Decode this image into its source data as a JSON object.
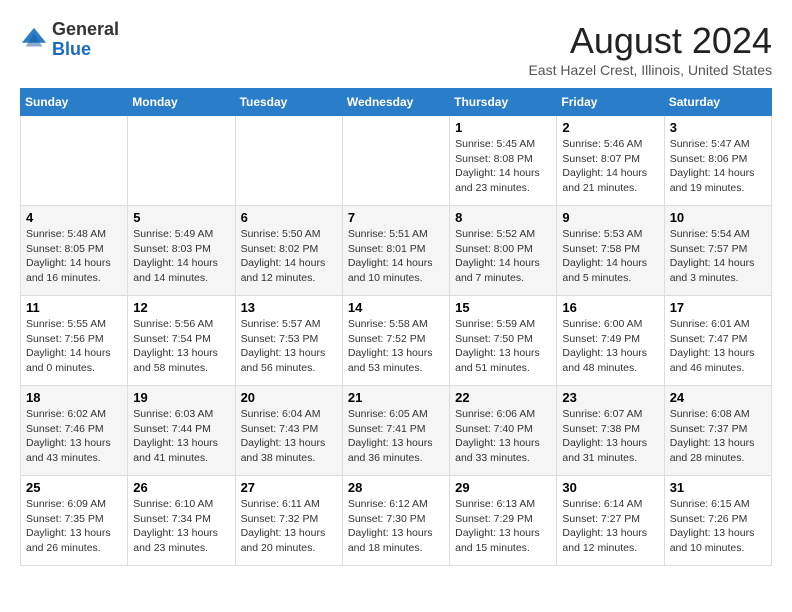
{
  "header": {
    "logo": {
      "line1": "General",
      "line2": "Blue"
    },
    "title": "August 2024",
    "location": "East Hazel Crest, Illinois, United States"
  },
  "weekdays": [
    "Sunday",
    "Monday",
    "Tuesday",
    "Wednesday",
    "Thursday",
    "Friday",
    "Saturday"
  ],
  "weeks": [
    [
      {
        "day": "",
        "sunrise": "",
        "sunset": "",
        "daylight": ""
      },
      {
        "day": "",
        "sunrise": "",
        "sunset": "",
        "daylight": ""
      },
      {
        "day": "",
        "sunrise": "",
        "sunset": "",
        "daylight": ""
      },
      {
        "day": "",
        "sunrise": "",
        "sunset": "",
        "daylight": ""
      },
      {
        "day": "1",
        "sunrise": "Sunrise: 5:45 AM",
        "sunset": "Sunset: 8:08 PM",
        "daylight": "Daylight: 14 hours and 23 minutes."
      },
      {
        "day": "2",
        "sunrise": "Sunrise: 5:46 AM",
        "sunset": "Sunset: 8:07 PM",
        "daylight": "Daylight: 14 hours and 21 minutes."
      },
      {
        "day": "3",
        "sunrise": "Sunrise: 5:47 AM",
        "sunset": "Sunset: 8:06 PM",
        "daylight": "Daylight: 14 hours and 19 minutes."
      }
    ],
    [
      {
        "day": "4",
        "sunrise": "Sunrise: 5:48 AM",
        "sunset": "Sunset: 8:05 PM",
        "daylight": "Daylight: 14 hours and 16 minutes."
      },
      {
        "day": "5",
        "sunrise": "Sunrise: 5:49 AM",
        "sunset": "Sunset: 8:03 PM",
        "daylight": "Daylight: 14 hours and 14 minutes."
      },
      {
        "day": "6",
        "sunrise": "Sunrise: 5:50 AM",
        "sunset": "Sunset: 8:02 PM",
        "daylight": "Daylight: 14 hours and 12 minutes."
      },
      {
        "day": "7",
        "sunrise": "Sunrise: 5:51 AM",
        "sunset": "Sunset: 8:01 PM",
        "daylight": "Daylight: 14 hours and 10 minutes."
      },
      {
        "day": "8",
        "sunrise": "Sunrise: 5:52 AM",
        "sunset": "Sunset: 8:00 PM",
        "daylight": "Daylight: 14 hours and 7 minutes."
      },
      {
        "day": "9",
        "sunrise": "Sunrise: 5:53 AM",
        "sunset": "Sunset: 7:58 PM",
        "daylight": "Daylight: 14 hours and 5 minutes."
      },
      {
        "day": "10",
        "sunrise": "Sunrise: 5:54 AM",
        "sunset": "Sunset: 7:57 PM",
        "daylight": "Daylight: 14 hours and 3 minutes."
      }
    ],
    [
      {
        "day": "11",
        "sunrise": "Sunrise: 5:55 AM",
        "sunset": "Sunset: 7:56 PM",
        "daylight": "Daylight: 14 hours and 0 minutes."
      },
      {
        "day": "12",
        "sunrise": "Sunrise: 5:56 AM",
        "sunset": "Sunset: 7:54 PM",
        "daylight": "Daylight: 13 hours and 58 minutes."
      },
      {
        "day": "13",
        "sunrise": "Sunrise: 5:57 AM",
        "sunset": "Sunset: 7:53 PM",
        "daylight": "Daylight: 13 hours and 56 minutes."
      },
      {
        "day": "14",
        "sunrise": "Sunrise: 5:58 AM",
        "sunset": "Sunset: 7:52 PM",
        "daylight": "Daylight: 13 hours and 53 minutes."
      },
      {
        "day": "15",
        "sunrise": "Sunrise: 5:59 AM",
        "sunset": "Sunset: 7:50 PM",
        "daylight": "Daylight: 13 hours and 51 minutes."
      },
      {
        "day": "16",
        "sunrise": "Sunrise: 6:00 AM",
        "sunset": "Sunset: 7:49 PM",
        "daylight": "Daylight: 13 hours and 48 minutes."
      },
      {
        "day": "17",
        "sunrise": "Sunrise: 6:01 AM",
        "sunset": "Sunset: 7:47 PM",
        "daylight": "Daylight: 13 hours and 46 minutes."
      }
    ],
    [
      {
        "day": "18",
        "sunrise": "Sunrise: 6:02 AM",
        "sunset": "Sunset: 7:46 PM",
        "daylight": "Daylight: 13 hours and 43 minutes."
      },
      {
        "day": "19",
        "sunrise": "Sunrise: 6:03 AM",
        "sunset": "Sunset: 7:44 PM",
        "daylight": "Daylight: 13 hours and 41 minutes."
      },
      {
        "day": "20",
        "sunrise": "Sunrise: 6:04 AM",
        "sunset": "Sunset: 7:43 PM",
        "daylight": "Daylight: 13 hours and 38 minutes."
      },
      {
        "day": "21",
        "sunrise": "Sunrise: 6:05 AM",
        "sunset": "Sunset: 7:41 PM",
        "daylight": "Daylight: 13 hours and 36 minutes."
      },
      {
        "day": "22",
        "sunrise": "Sunrise: 6:06 AM",
        "sunset": "Sunset: 7:40 PM",
        "daylight": "Daylight: 13 hours and 33 minutes."
      },
      {
        "day": "23",
        "sunrise": "Sunrise: 6:07 AM",
        "sunset": "Sunset: 7:38 PM",
        "daylight": "Daylight: 13 hours and 31 minutes."
      },
      {
        "day": "24",
        "sunrise": "Sunrise: 6:08 AM",
        "sunset": "Sunset: 7:37 PM",
        "daylight": "Daylight: 13 hours and 28 minutes."
      }
    ],
    [
      {
        "day": "25",
        "sunrise": "Sunrise: 6:09 AM",
        "sunset": "Sunset: 7:35 PM",
        "daylight": "Daylight: 13 hours and 26 minutes."
      },
      {
        "day": "26",
        "sunrise": "Sunrise: 6:10 AM",
        "sunset": "Sunset: 7:34 PM",
        "daylight": "Daylight: 13 hours and 23 minutes."
      },
      {
        "day": "27",
        "sunrise": "Sunrise: 6:11 AM",
        "sunset": "Sunset: 7:32 PM",
        "daylight": "Daylight: 13 hours and 20 minutes."
      },
      {
        "day": "28",
        "sunrise": "Sunrise: 6:12 AM",
        "sunset": "Sunset: 7:30 PM",
        "daylight": "Daylight: 13 hours and 18 minutes."
      },
      {
        "day": "29",
        "sunrise": "Sunrise: 6:13 AM",
        "sunset": "Sunset: 7:29 PM",
        "daylight": "Daylight: 13 hours and 15 minutes."
      },
      {
        "day": "30",
        "sunrise": "Sunrise: 6:14 AM",
        "sunset": "Sunset: 7:27 PM",
        "daylight": "Daylight: 13 hours and 12 minutes."
      },
      {
        "day": "31",
        "sunrise": "Sunrise: 6:15 AM",
        "sunset": "Sunset: 7:26 PM",
        "daylight": "Daylight: 13 hours and 10 minutes."
      }
    ]
  ]
}
